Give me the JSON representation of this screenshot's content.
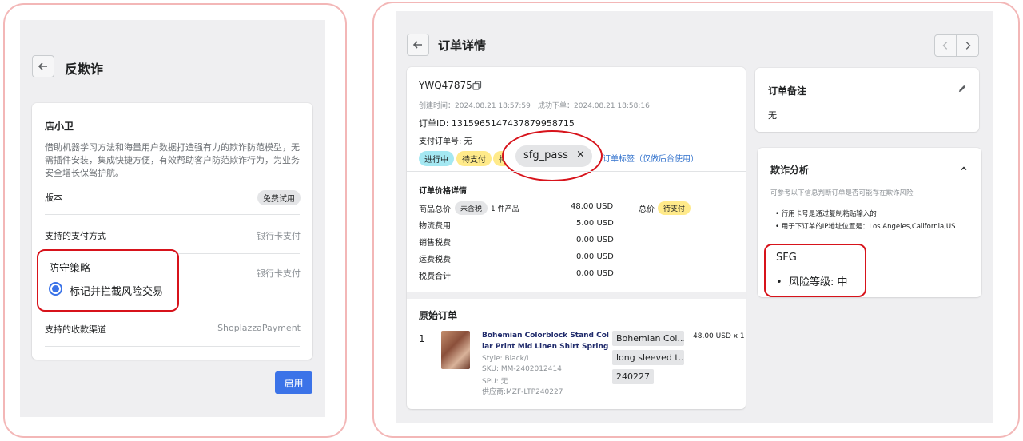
{
  "left": {
    "title": "反欺诈",
    "app_name": "店小卫",
    "description_lines": [
      "借助机器学习方法和海量用户数据打造强有力的欺诈防范模型，无",
      "需插件安装，集成快捷方便，有效帮助客户防范欺诈行为，为业务",
      "安全增长保驾护航。"
    ],
    "version_label": "版本",
    "version_badge": "免费试用",
    "payment_label": "支持的支付方式",
    "payment_value": "银行卡支付",
    "defense_label": "防守策略",
    "defense_option": "标记并拦截风险交易",
    "defense_value": "银行卡支付",
    "channel_label": "支持的收款渠道",
    "channel_value": "ShoplazzaPayment",
    "enable_button": "启用"
  },
  "right": {
    "title": "订单详情",
    "order_no": "YWQ47875",
    "created_label": "创建时间：",
    "created_time": "2024.08.21 18:57:59",
    "success_label": "成功下单：",
    "success_time": "2024.08.21 18:58:16",
    "order_id": "订单ID: 1315965147437879958715",
    "pay_order_no": "支付订单号: 无",
    "tag_processing": "进行中",
    "tag_pending": "待支付",
    "tag_partial": "待",
    "tag_sfg": "sfg_pass",
    "tag_sfg_close": "×",
    "tag_link": "订单标签（仅做后台使用）",
    "price_section": "订单价格详情",
    "price_rows": [
      {
        "label": "商品总价",
        "value": "48.00 USD"
      },
      {
        "label": "物流费用",
        "value": "5.00 USD"
      },
      {
        "label": "销售税费",
        "value": "0.00 USD"
      },
      {
        "label": "运费税费",
        "value": "0.00 USD"
      },
      {
        "label": "税费合计",
        "value": "0.00 USD"
      }
    ],
    "tax_badge": "未含税",
    "items_count": "1 件产品",
    "total_label": "总价",
    "total_badge": "待支付",
    "original_section": "原始订单",
    "item_index": "1",
    "product_title_1": "Bohemian Colorblock Stand Col",
    "product_title_2": "lar Print Mid Linen Shirt Spring",
    "product_style": "Style: Black/L",
    "product_sku": "SKU: MM-2402012414",
    "product_spu": "SPU: 无",
    "product_supplier": "供应商:MZF-LTP240227",
    "chip_1": "Bohemian Col...",
    "chip_2": "long sleeved t...",
    "chip_3": "240227",
    "item_price": "48.00 USD x 1",
    "note_title": "订单备注",
    "note_value": "无",
    "fraud_title": "欺诈分析",
    "fraud_hint": "可参考以下信息判断订单是否可能存在欺诈风险",
    "fraud_items": [
      "行用卡号是通过复制粘贴输入的",
      "用于下订单的IP地址位置是：Los Angeles,California,US"
    ],
    "sfg_label": "SFG",
    "risk_label": "风险等级:",
    "risk_value": "中"
  },
  "colors": {
    "accent": "#3b73e8",
    "highlight_ring": "#d7131b",
    "frame": "#f3b7b7",
    "badge_blue": "#a4e8f2",
    "badge_yellow": "#ffea8a"
  }
}
